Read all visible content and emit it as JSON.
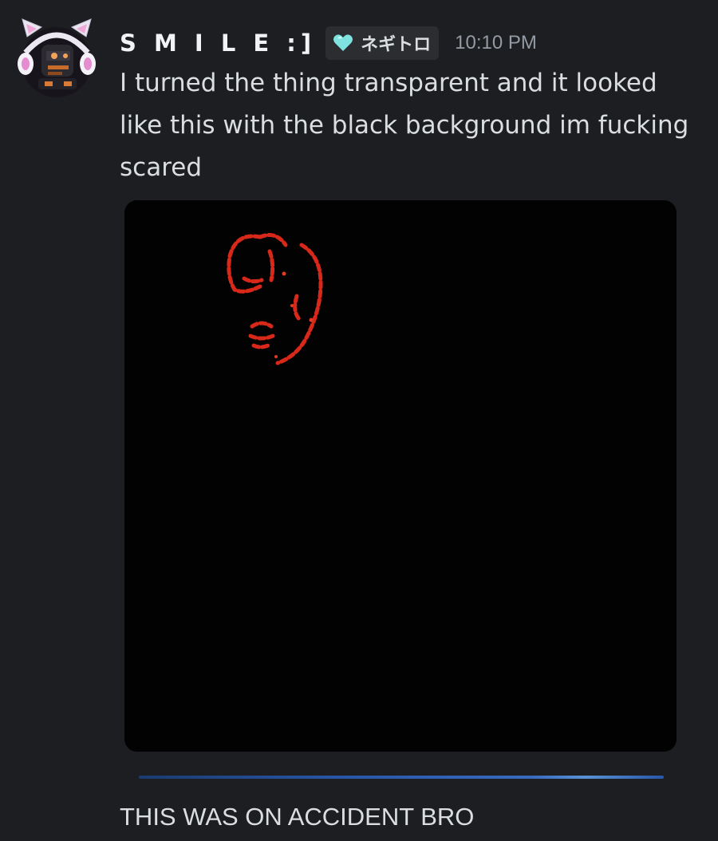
{
  "message": {
    "author": {
      "username": "S M I L E :]",
      "avatar_icon": "robot-headphones-avatar-icon",
      "role_tag": {
        "icon": "heart-icon",
        "icon_color": "#7fe3e0",
        "label": "ネギトロ"
      }
    },
    "timestamp": "10:10 PM",
    "text": "I turned the thing transparent and it looked like this with the black background im fucking scared",
    "attachment": {
      "type": "image",
      "background_color": "#020202",
      "figure_color": "#d8281a"
    }
  },
  "next_message": {
    "text": "THIS WAS ON ACCIDENT BRO"
  },
  "colors": {
    "background": "#1d1e22",
    "username": "#f2f3f5",
    "text": "#dbdee1",
    "timestamp": "#949ba4",
    "tag_background": "#2b2d31"
  }
}
